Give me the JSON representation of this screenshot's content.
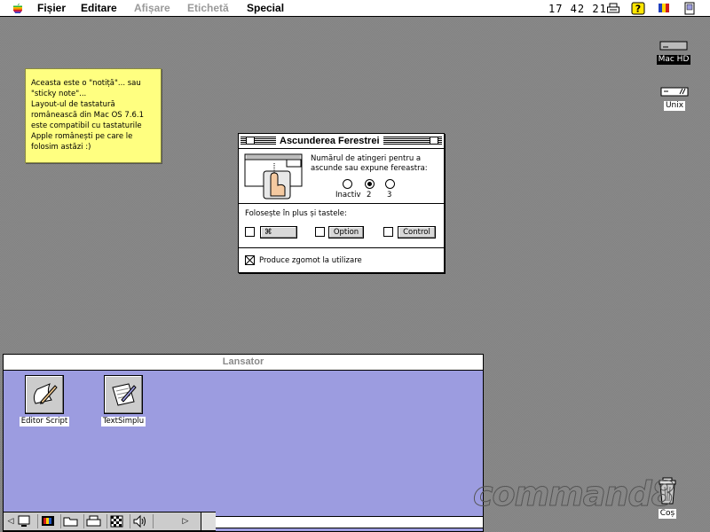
{
  "menubar": {
    "items": [
      {
        "label": "Fișier",
        "enabled": true
      },
      {
        "label": "Editare",
        "enabled": true
      },
      {
        "label": "Afișare",
        "enabled": false
      },
      {
        "label": "Etichetă",
        "enabled": false
      },
      {
        "label": "Special",
        "enabled": true
      }
    ],
    "clock": "17 42 21",
    "status_icons": [
      "printer-icon",
      "help-icon",
      "romanian-flag-icon",
      "app-menu-icon"
    ]
  },
  "desktop": {
    "icons": [
      {
        "name": "Mac HD",
        "icon": "hard-disk-icon"
      },
      {
        "name": "Unix",
        "icon": "unix-volume-icon"
      },
      {
        "name": "Coș",
        "icon": "trash-icon"
      }
    ],
    "watermark": "command8"
  },
  "sticky_note": {
    "lines": [
      "Aceasta este o \"notiță\"... sau",
      "\"sticky note\"...",
      "Layout-ul de tastatură",
      "românească din Mac OS 7.6.1",
      "este compatibil cu tastaturile",
      "Apple românești pe care le",
      "folosim astăzi :)"
    ]
  },
  "control_panel": {
    "title": "Ascunderea Ferestrei",
    "description_line1": "Numărul de atingeri pentru a",
    "description_line2": "ascunde sau expune fereastra:",
    "radio_options": [
      {
        "label": "Inactiv",
        "selected": false
      },
      {
        "label": "2",
        "selected": true
      },
      {
        "label": "3",
        "selected": false
      }
    ],
    "modifiers_label": "Folosește în plus și tastele:",
    "modifier_keys": [
      {
        "label": "⌘",
        "checked": false
      },
      {
        "label": "Option",
        "checked": false
      },
      {
        "label": "Control",
        "checked": false
      }
    ],
    "sound_label": "Produce zgomot la utilizare",
    "sound_checked": true
  },
  "launcher": {
    "title": "Lansator",
    "background_color": "#9c9ce0",
    "apps": [
      {
        "label": "Editor Script",
        "icon": "script-editor-icon"
      },
      {
        "label": "TextSimplu",
        "icon": "text-editor-icon"
      }
    ]
  },
  "control_strip": {
    "modules": [
      "monitor-icon",
      "color-depth-icon",
      "file-sharing-icon",
      "printer-icon",
      "pattern-icon",
      "sound-volume-icon"
    ]
  }
}
